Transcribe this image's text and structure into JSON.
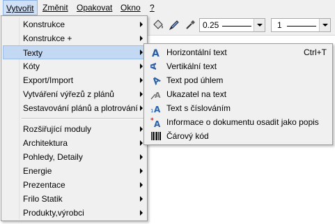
{
  "menubar": {
    "items": [
      {
        "label": "Vytvořit"
      },
      {
        "label": "Změnit"
      },
      {
        "label": "Opakovat"
      },
      {
        "label": "Okno"
      },
      {
        "label": "?"
      }
    ]
  },
  "toolbar": {
    "combo1_value": "0.25",
    "combo2_value": "1"
  },
  "main_menu": {
    "items": [
      {
        "label": "Konstrukce"
      },
      {
        "label": "Konstrukce +"
      },
      {
        "label": "Texty"
      },
      {
        "label": "Kóty"
      },
      {
        "label": "Export/Import"
      },
      {
        "label": "Vytváření výřezů z plánů"
      },
      {
        "label": "Sestavování plánů a plotrování"
      },
      {
        "label": "Rozšiřující moduly"
      },
      {
        "label": "Architektura"
      },
      {
        "label": "Pohledy, Detaily"
      },
      {
        "label": "Energie"
      },
      {
        "label": "Prezentace"
      },
      {
        "label": "Frilo Statik"
      },
      {
        "label": "Produkty,výrobci"
      }
    ]
  },
  "submenu": {
    "items": [
      {
        "label": "Horizontální text",
        "shortcut": "Ctrl+T",
        "icon": "horizontal-text-icon"
      },
      {
        "label": "Vertikální text",
        "icon": "vertical-text-icon"
      },
      {
        "label": "Text pod úhlem",
        "icon": "angled-text-icon"
      },
      {
        "label": "Ukazatel na text",
        "icon": "text-pointer-icon"
      },
      {
        "label": "Text s číslováním",
        "icon": "numbered-text-icon"
      },
      {
        "label": "Informace o dokumentu osadit jako popis",
        "icon": "document-info-icon"
      },
      {
        "label": "Čárový kód",
        "icon": "barcode-icon"
      }
    ]
  },
  "colors": {
    "highlight": "#c3d8f3",
    "icon_blue": "#2b5fa8",
    "icon_red": "#cc2020"
  }
}
